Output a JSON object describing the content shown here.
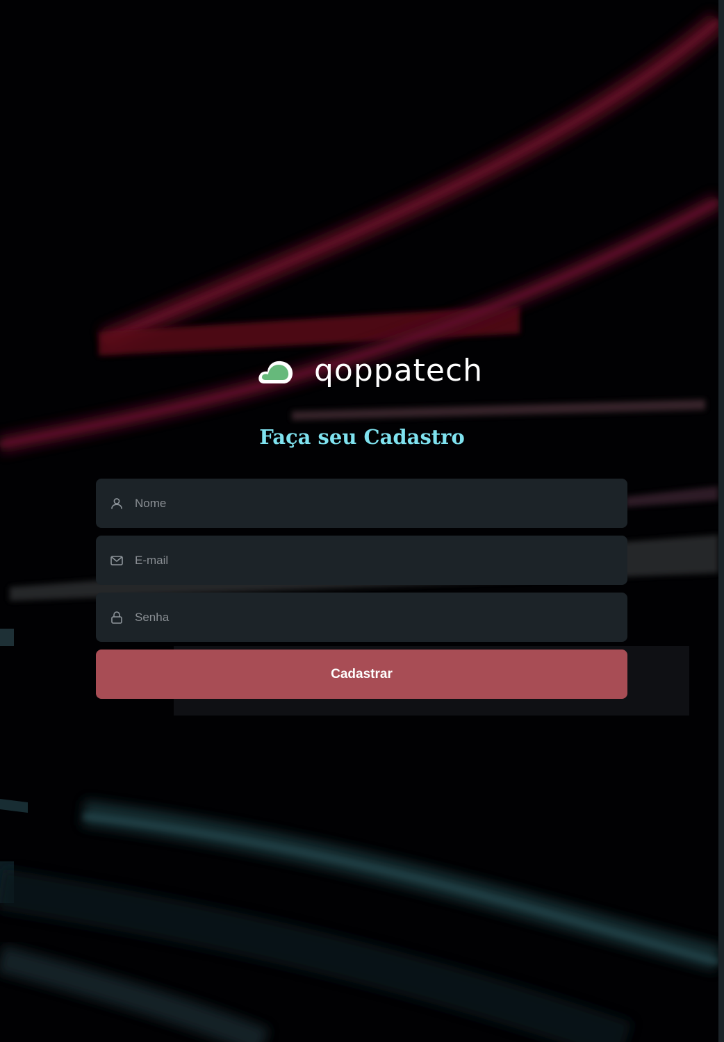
{
  "brand": {
    "name": "qoppatech",
    "logo_icon": "cloud-icon",
    "logo_color": "#66b97b"
  },
  "page": {
    "heading": "Faça seu Cadastro"
  },
  "form": {
    "fields": [
      {
        "icon": "user-icon",
        "placeholder": "Nome",
        "value": ""
      },
      {
        "icon": "mail-icon",
        "placeholder": "E-mail",
        "value": ""
      },
      {
        "icon": "lock-icon",
        "placeholder": "Senha",
        "value": ""
      }
    ],
    "submit_label": "Cadastrar"
  },
  "colors": {
    "heading": "#7fe2ef",
    "button": "#a84d55",
    "field_background": "#1c2328"
  }
}
